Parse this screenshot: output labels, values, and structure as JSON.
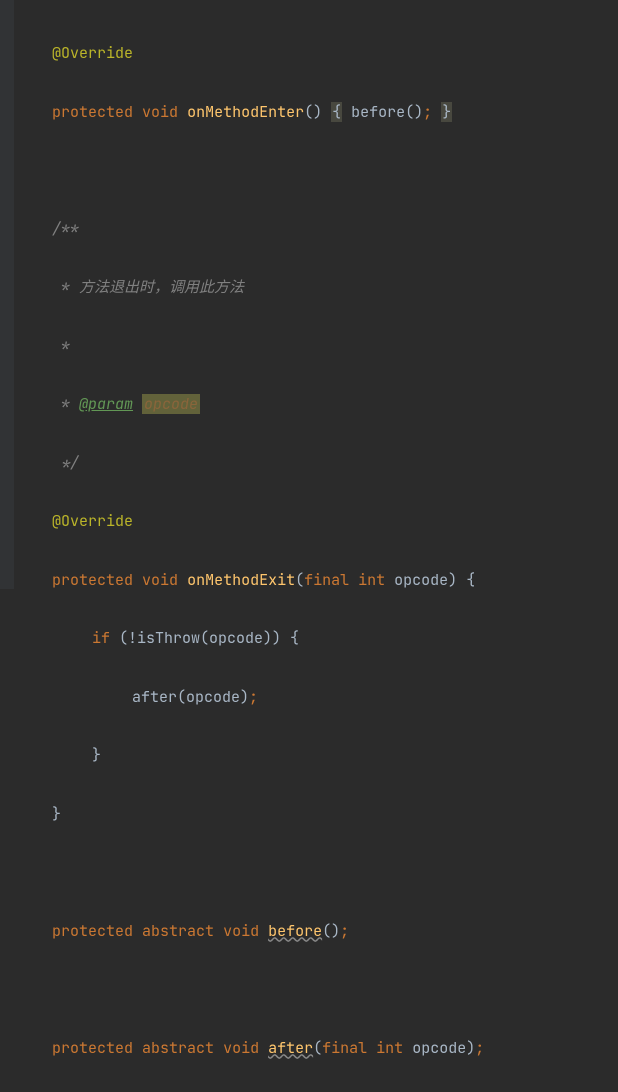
{
  "code": {
    "line1_annotation": "@Override",
    "line2_kw_protected": "protected",
    "line2_kw_void": "void",
    "line2_method": "onMethodEnter",
    "line2_parens": "()",
    "line2_brace_open": "{",
    "line2_call": "before",
    "line2_call_parens": "()",
    "line2_semi": ";",
    "line2_brace_close": "}",
    "line3_comment_open": "/**",
    "line4_comment": " * 方法退出时，调用此方法",
    "line5_comment": " *",
    "line6_prefix": " * ",
    "line6_tag": "@param",
    "line6_space": " ",
    "line6_param": "opcode",
    "line7_comment_close": " */",
    "line8_annotation": "@Override",
    "line9_kw_protected": "protected",
    "line9_kw_void": "void",
    "line9_method": "onMethodExit",
    "line9_paren_open": "(",
    "line9_kw_final": "final",
    "line9_kw_int": "int",
    "line9_param": "opcode",
    "line9_paren_close": ")",
    "line9_brace": "{",
    "line10_kw_if": "if",
    "line10_cond": " (!isThrow(opcode)) {",
    "line11_call": "after",
    "line11_args": "(opcode)",
    "line11_semi": ";",
    "line12_brace": "}",
    "line13_brace": "}",
    "line14_kw_protected": "protected",
    "line14_kw_abstract": "abstract",
    "line14_kw_void": "void",
    "line14_method": "before",
    "line14_parens": "()",
    "line14_semi": ";",
    "line15_kw_protected": "protected",
    "line15_kw_abstract": "abstract",
    "line15_kw_void": "void",
    "line15_method": "after",
    "line15_paren_open": "(",
    "line15_kw_final": "final",
    "line15_kw_int": "int",
    "line15_param": "opcode",
    "line15_paren_close": ")",
    "line15_semi": ";"
  }
}
